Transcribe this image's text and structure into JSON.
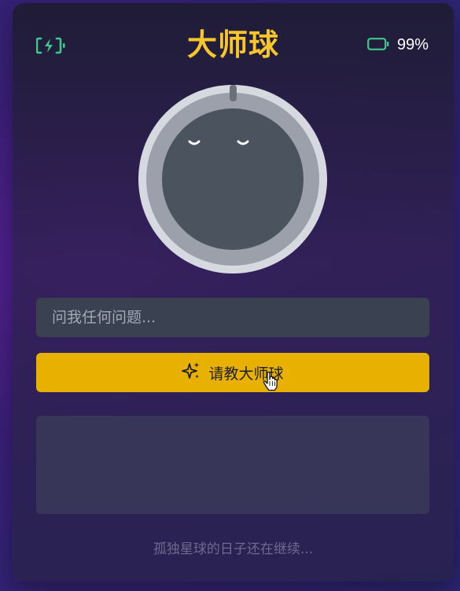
{
  "header": {
    "title": "大师球",
    "battery_left_icon": "battery-charging-icon",
    "battery_right_icon": "battery-icon",
    "battery_percent": "99%"
  },
  "magic_ball": {
    "icon": "sleeping-face-ball"
  },
  "question_input": {
    "placeholder": "问我任何问题...",
    "value": ""
  },
  "ask_button": {
    "label": "请教大师球",
    "icon": "sparkles-icon"
  },
  "answer_panel": {
    "text": ""
  },
  "footer": {
    "text": "孤独星球的日子还在继续..."
  },
  "colors": {
    "title": "#f8c62b",
    "accent_green": "#3ec98a",
    "button": "#e8b102",
    "input_bg": "#3a4150"
  }
}
